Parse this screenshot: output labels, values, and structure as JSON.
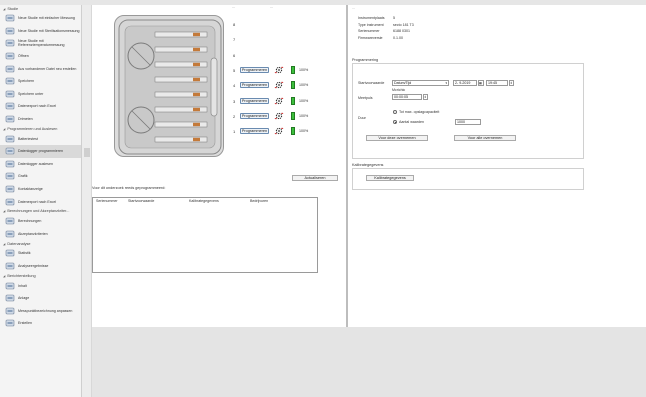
{
  "sidebar": {
    "sections": [
      {
        "label": "Studie",
        "items": [
          {
            "label": "Neue Studie mit einfacher Messung",
            "icon": "syringe-icon"
          },
          {
            "label": "Neue Studie mit Sterilisationsmessung",
            "icon": "syringe-icon"
          },
          {
            "label": "Neue Studie mit Referenztemperaturmessung",
            "icon": "syringe-icon"
          },
          {
            "label": "Öffnen",
            "icon": "folder-open-icon"
          },
          {
            "label": "Aus vorhandener Datei neu erstellen",
            "icon": "syringe-icon"
          },
          {
            "label": "Speichern",
            "icon": "save-icon"
          },
          {
            "label": "Speichern unter",
            "icon": "save-as-icon"
          },
          {
            "label": "Datenexport nach Excel",
            "icon": "excel-export-icon"
          },
          {
            "label": "Drimeten",
            "icon": "gear-icon"
          }
        ]
      },
      {
        "label": "Programmieren und Auslesen",
        "items": [
          {
            "label": "Batteriestest",
            "icon": "battery-test-icon"
          },
          {
            "label": "Datenlogger programmieren",
            "icon": "logger-program-icon"
          },
          {
            "label": "Datenlogger auslesen",
            "icon": "logger-read-icon"
          }
        ]
      },
      {
        "label": "",
        "items": [
          {
            "label": "Grafik",
            "icon": "graph-icon"
          },
          {
            "label": "Kontaktanzeige",
            "icon": "table-icon"
          },
          {
            "label": "Datenexport nach Excel",
            "icon": "excel-export-icon"
          }
        ]
      },
      {
        "label": "Berechnungen und Akzeptanzkriter...",
        "items": [
          {
            "label": "Berechnungen",
            "icon": "calc-icon"
          },
          {
            "label": "Akzeptanzkriterien",
            "icon": "check-icon"
          }
        ]
      },
      {
        "label": "Datenanalyse",
        "items": [
          {
            "label": "Statistik",
            "icon": "stats-icon"
          },
          {
            "label": "Analyseergebnisse",
            "icon": "analysis-icon"
          }
        ]
      },
      {
        "label": "Berichterstellung",
        "items": [
          {
            "label": "Inhalt",
            "icon": "content-icon"
          },
          {
            "label": "Anlage",
            "icon": "attachment-icon"
          },
          {
            "label": "Messpunktbezeichnung anpassen",
            "icon": "edit-icon"
          },
          {
            "label": "Erstellen",
            "icon": "print-icon"
          }
        ]
      }
    ]
  },
  "header": {
    "cut_left": "...",
    "cut_right": "..."
  },
  "case": {
    "slots": [
      {
        "num": "8",
        "has_controls": false
      },
      {
        "num": "7",
        "has_controls": false
      },
      {
        "num": "6",
        "has_controls": false
      },
      {
        "num": "5",
        "has_controls": true,
        "button": "Programmeren",
        "pct": "100%"
      },
      {
        "num": "4",
        "has_controls": true,
        "button": "Programmeren",
        "pct": "100%"
      },
      {
        "num": "3",
        "has_controls": true,
        "button": "Programmeren",
        "pct": "100%"
      },
      {
        "num": "2",
        "has_controls": true,
        "button": "Programmeren",
        "pct": "100%"
      },
      {
        "num": "1",
        "has_controls": true,
        "button": "Programmeren",
        "pct": "100%"
      }
    ]
  },
  "actions": {
    "refresh": "Actualiseren"
  },
  "table": {
    "title": "Voor dit onderzoek reeds geprogrammeerd:",
    "columns": [
      "Serienummer",
      "Startvoorwaarde",
      "Kalibrategegevens",
      "Bedrijvuren"
    ]
  },
  "info": {
    "rows": [
      {
        "k": "Instrumentplaats",
        "v": "5"
      },
      {
        "k": "Type instrument",
        "v": "secto 181 T3"
      },
      {
        "k": "Serienummer",
        "v": "6188 0301"
      },
      {
        "k": "Firmwareversie",
        "v": "0.1.00"
      }
    ]
  },
  "programming": {
    "title": "Programmering",
    "start_label": "Startvoorwaarde",
    "start_value": "Datum/Tijd",
    "date": "2- 9-2019",
    "time": "19:45",
    "cycle_label": "Mcrichic",
    "interval_label": "Meetpuls",
    "interval_value": "00:00:05",
    "duur_label": "Duur",
    "radio1": "Tot max. opslagcapaciteit",
    "radio2": "Aantal waarden",
    "aantal_value": "1000",
    "btn_apply_one": "Voor deze overnemen",
    "btn_apply_all": "Voor alle overnemen"
  },
  "calibration": {
    "title": "Kalibrategegevens",
    "button": "Kalibrategegevens"
  },
  "colors": {
    "accent": "#6a8bb0",
    "battery": "#3cbf3c",
    "gear_red": "#c62828"
  }
}
